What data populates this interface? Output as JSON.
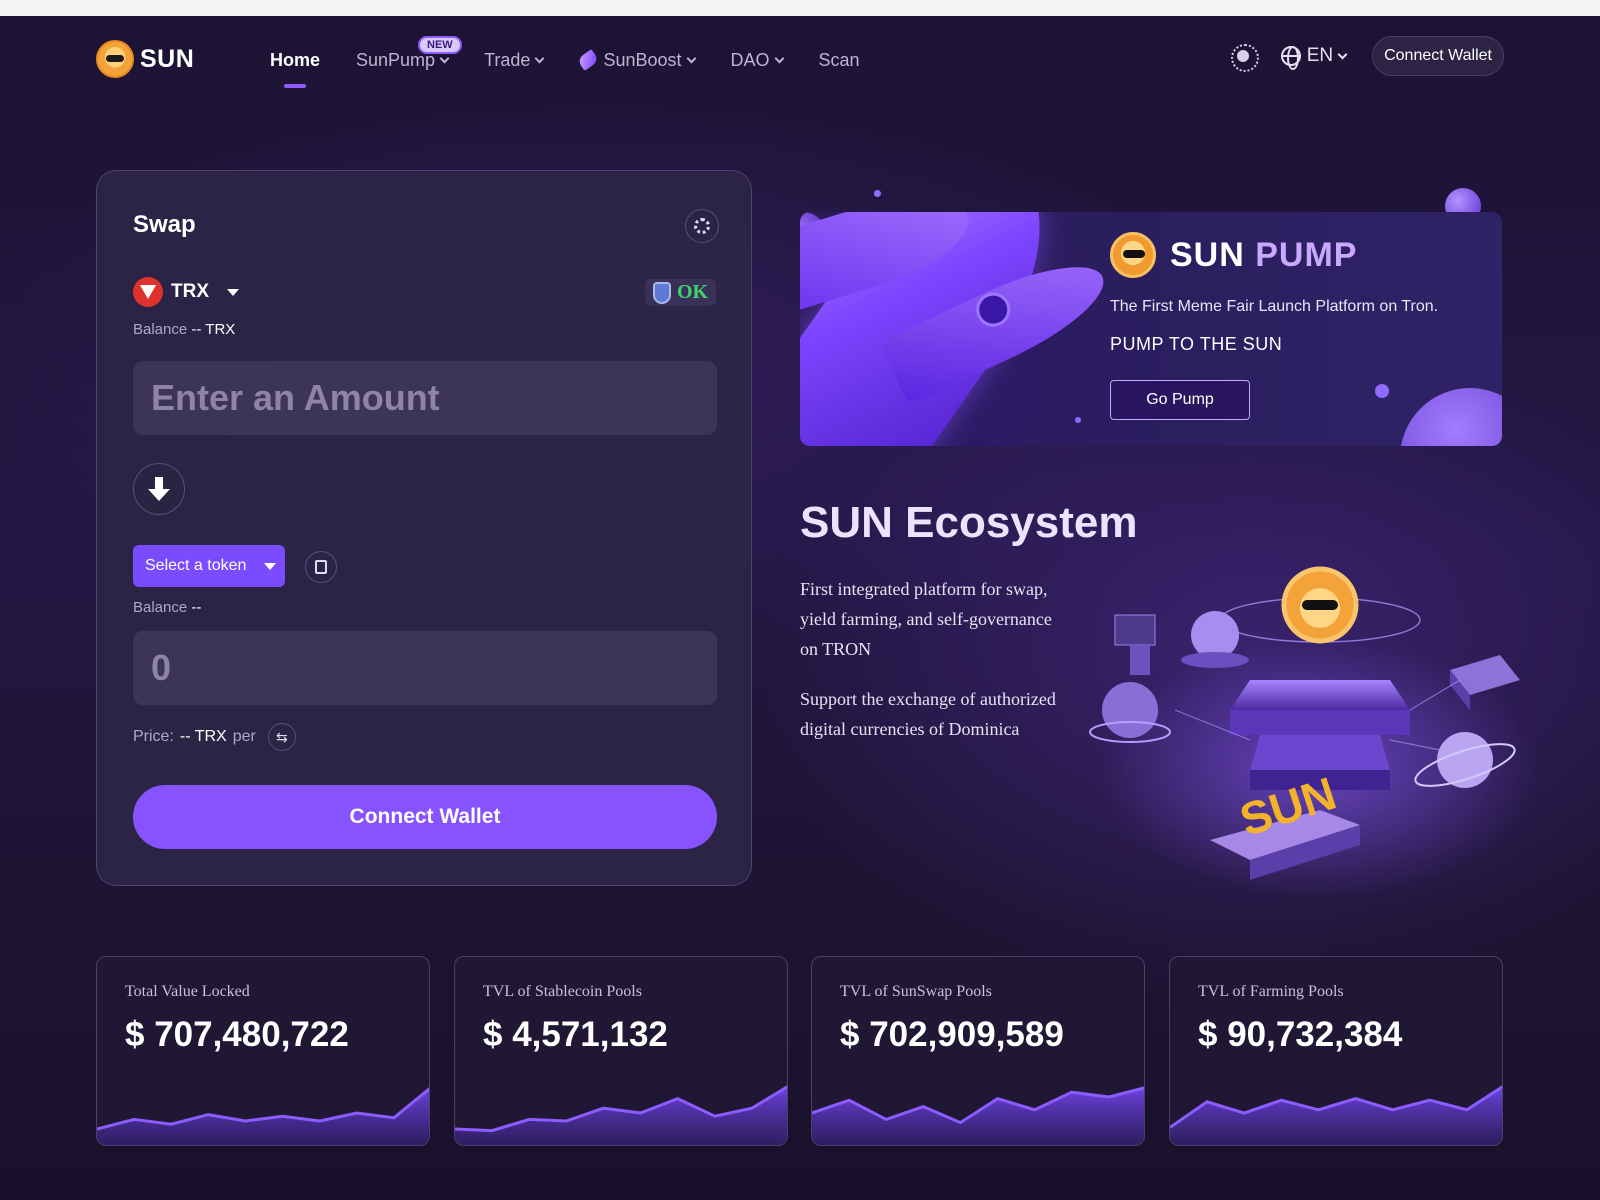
{
  "nav": {
    "logo_text": "SUN",
    "items": [
      {
        "label": "Home"
      },
      {
        "label": "SunPump",
        "badge": "NEW"
      },
      {
        "label": "Trade"
      },
      {
        "label": "SunBoost"
      },
      {
        "label": "DAO"
      },
      {
        "label": "Scan"
      }
    ],
    "language": "EN",
    "connect_label": "Connect Wallet"
  },
  "swap": {
    "title": "Swap",
    "from_token": "TRX",
    "ok_label": "OK",
    "from_balance_label": "Balance",
    "from_balance_value": "-- TRX",
    "amount_placeholder": "Enter an Amount",
    "select_token_label": "Select a token",
    "to_balance_label": "Balance",
    "to_balance_value": "--",
    "to_amount": "0",
    "price_label": "Price:",
    "price_value": "-- TRX",
    "price_per": "per",
    "connect_label": "Connect Wallet"
  },
  "banner": {
    "brand_white": "SUN",
    "brand_purple": "PUMP",
    "subtitle": "The First Meme Fair Launch Platform on Tron.",
    "tagline": "PUMP TO THE SUN",
    "button": "Go Pump"
  },
  "ecosystem": {
    "title": "SUN Ecosystem",
    "para1": "First integrated platform for swap, yield farming, and self-governance on TRON",
    "para2": "Support the exchange of authorized digital currencies of Dominica",
    "illustration_text": "SUN"
  },
  "stats": [
    {
      "label": "Total Value Locked",
      "value": "$ 707,480,722",
      "spark": [
        20,
        32,
        26,
        38,
        30,
        36,
        30,
        40,
        34,
        72
      ]
    },
    {
      "label": "TVL of Stablecoin Pools",
      "value": "$ 4,571,132",
      "spark": [
        20,
        18,
        32,
        30,
        46,
        40,
        58,
        36,
        46,
        74
      ]
    },
    {
      "label": "TVL of SunSwap Pools",
      "value": "$ 702,909,589",
      "spark": [
        40,
        56,
        32,
        48,
        28,
        58,
        44,
        66,
        60,
        72
      ]
    },
    {
      "label": "TVL of Farming Pools",
      "value": "$ 90,732,384",
      "spark": [
        22,
        54,
        40,
        56,
        44,
        58,
        44,
        56,
        44,
        74
      ]
    }
  ],
  "colors": {
    "accent": "#8653ff",
    "background": "#1c1334",
    "ok_green": "#3fd26e"
  }
}
